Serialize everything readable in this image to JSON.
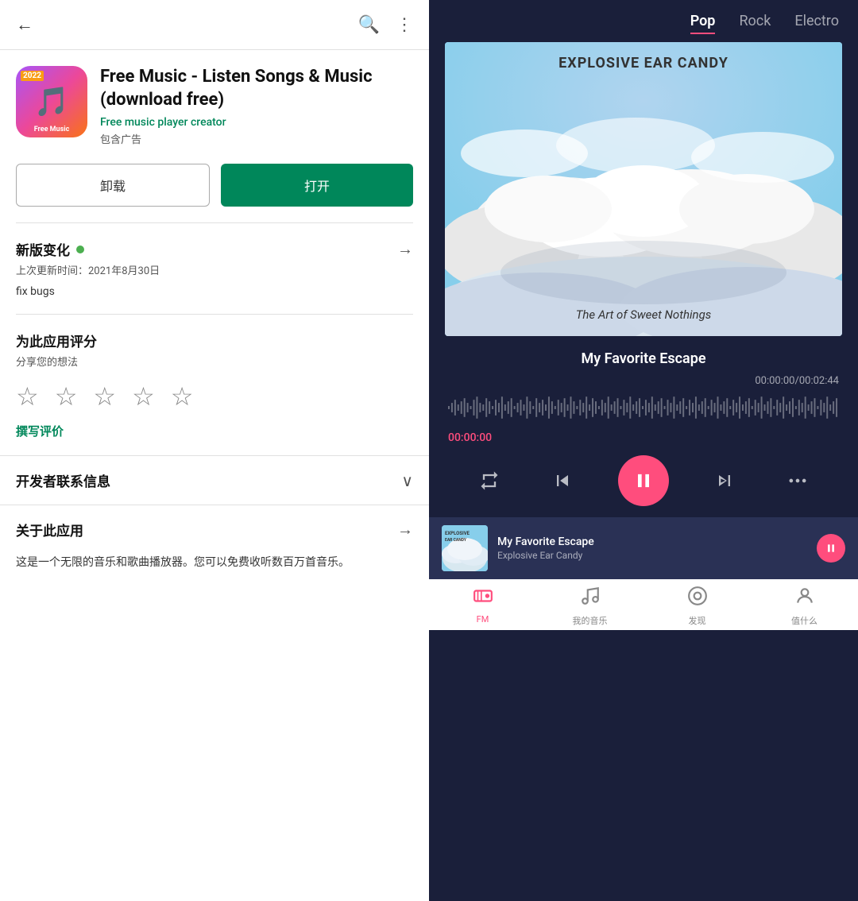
{
  "left": {
    "back_label": "←",
    "search_icon": "🔍",
    "more_icon": "⋮",
    "app_icon_year": "2022",
    "app_icon_name": "Free Music",
    "app_title": "Free Music - Listen Songs & Music (download free)",
    "app_developer": "Free music player creator",
    "app_ads": "包含广告",
    "btn_uninstall": "卸载",
    "btn_open": "打开",
    "changelog_title": "新版变化",
    "changelog_date": "上次更新时间：2021年8月30日",
    "changelog_text": "fix bugs",
    "rating_title": "为此应用评分",
    "rating_subtitle": "分享您的想法",
    "write_review": "撰写评价",
    "developer_title": "开发者联系信息",
    "about_title": "关于此应用",
    "about_desc": "这是一个无限的音乐和歌曲播放器。您可以免费收听数百万首音乐。"
  },
  "right": {
    "tabs": [
      {
        "label": "Pop",
        "active": true
      },
      {
        "label": "Rock",
        "active": false
      },
      {
        "label": "Electro",
        "active": false
      }
    ],
    "album_title": "EXPLOSIVE EAR CANDY",
    "album_subtitle": "The Art of Sweet Nothings",
    "song_title": "My Favorite Escape",
    "time_current": "00:00:00",
    "time_total": "00:02:44",
    "time_display": "00:00:00/00:02:44",
    "current_time_display": "00:00:00",
    "mini_song_title": "My Favorite Escape",
    "mini_artist": "Explosive Ear Candy",
    "nav_items": [
      {
        "label": "FM",
        "icon": "fm",
        "active": true
      },
      {
        "label": "我的音乐",
        "icon": "music",
        "active": false
      },
      {
        "label": "发现",
        "icon": "discover",
        "active": false
      },
      {
        "label": "值什么",
        "icon": "user",
        "active": false
      }
    ]
  }
}
